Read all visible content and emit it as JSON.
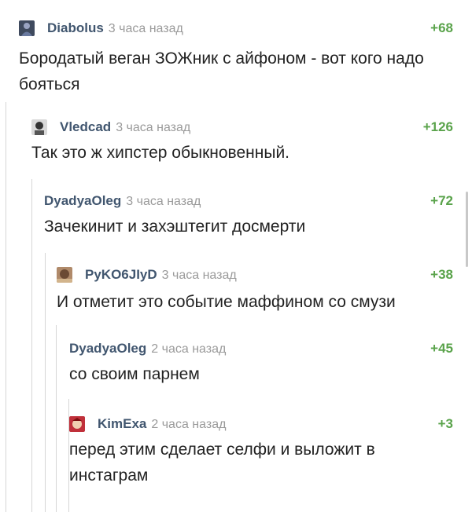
{
  "comments": [
    {
      "author": "Diabolus",
      "time": "3 часа назад",
      "rating": "+68",
      "text": "Бородатый веган ЗОЖник с айфоном - вот кого надо бояться"
    },
    {
      "author": "Vledcad",
      "time": "3 часа назад",
      "rating": "+126",
      "text": "Так это ж хипстер обыкновенный."
    },
    {
      "author": "DyadyaOleg",
      "time": "3 часа назад",
      "rating": "+72",
      "text": "Зачекинит и захэштегит досмерти"
    },
    {
      "author": "PyKO6JIyD",
      "time": "3 часа назад",
      "rating": "+38",
      "text": "И отметит это событие маффином со смузи"
    },
    {
      "author": "DyadyaOleg",
      "time": "2 часа назад",
      "rating": "+45",
      "text": "со своим парнем"
    },
    {
      "author": "KimExa",
      "time": "2 часа назад",
      "rating": "+3",
      "text": "перед этим сделает селфи и выложит в инстаграм"
    }
  ],
  "colors": {
    "author": "#41566f",
    "rating": "#5aa34b",
    "time": "#9a9a9a",
    "thread_line": "#d6d6d6"
  }
}
